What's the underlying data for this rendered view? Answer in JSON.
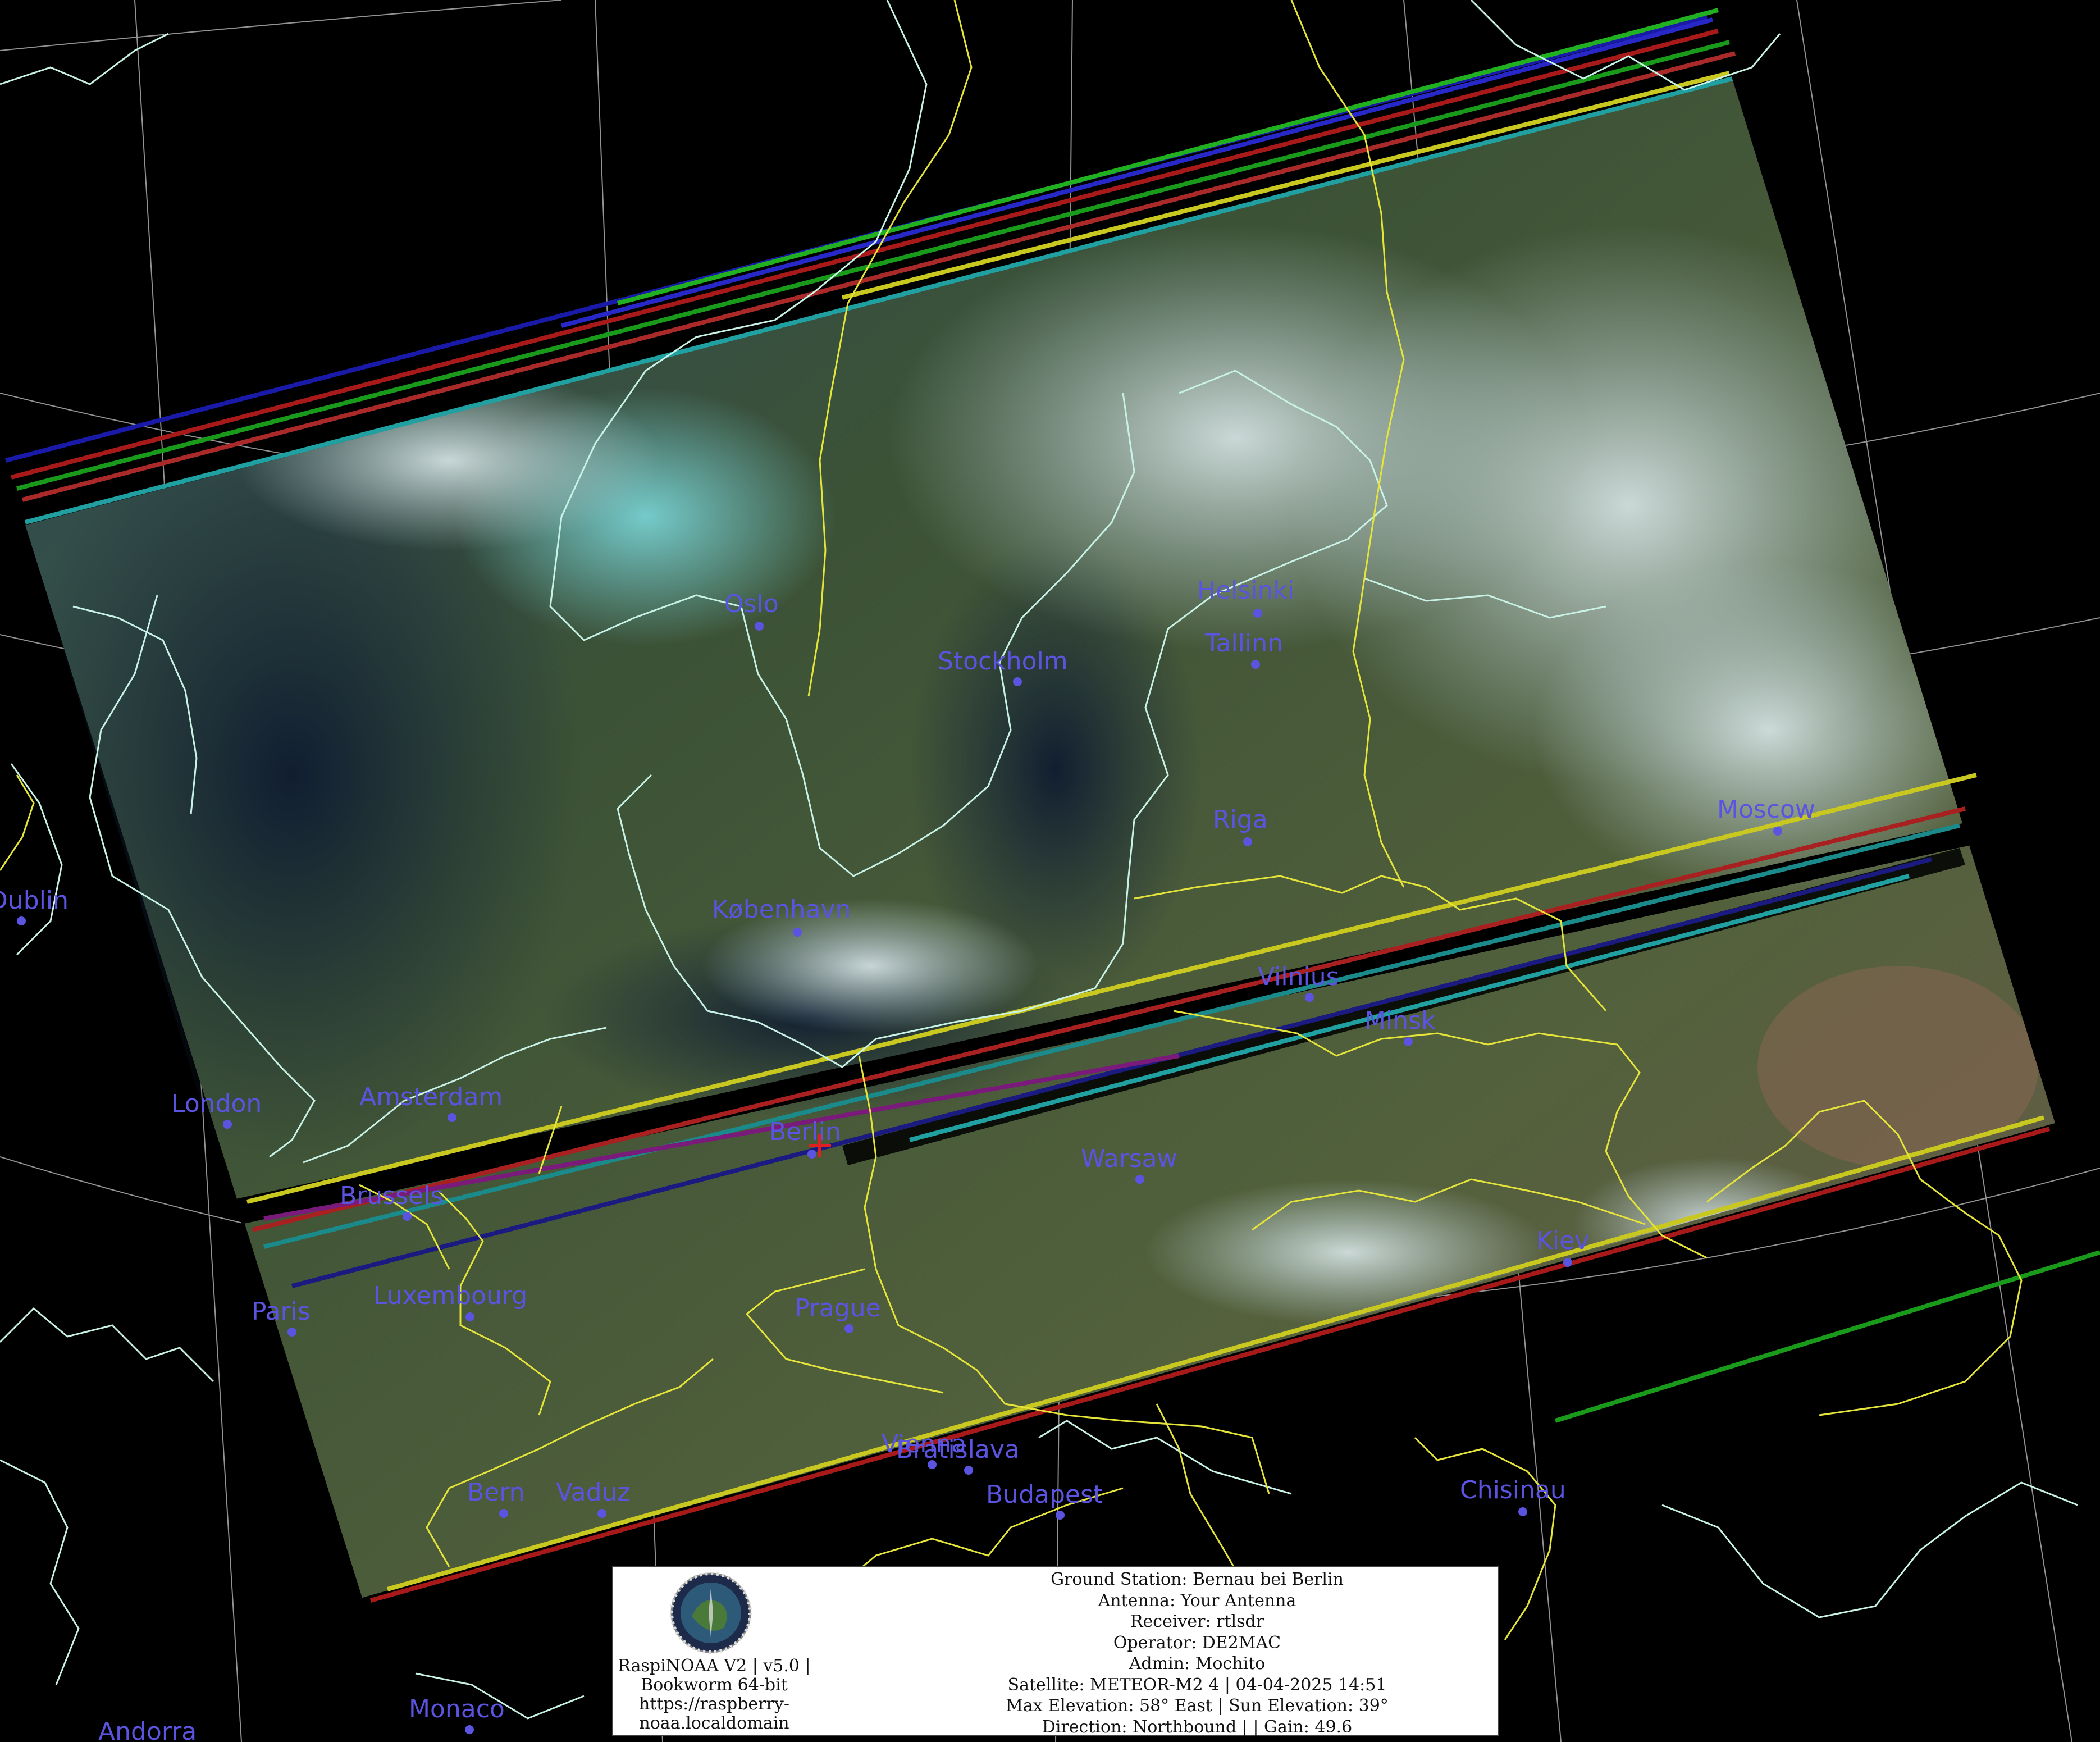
{
  "map": {
    "cities": [
      {
        "name": "Oslo"
      },
      {
        "name": "Stockholm"
      },
      {
        "name": "Helsinki"
      },
      {
        "name": "Tallinn"
      },
      {
        "name": "Riga"
      },
      {
        "name": "Moscow"
      },
      {
        "name": "København"
      },
      {
        "name": "Vilnius"
      },
      {
        "name": "Minsk"
      },
      {
        "name": "Dublin"
      },
      {
        "name": "London"
      },
      {
        "name": "Amsterdam"
      },
      {
        "name": "Berlin"
      },
      {
        "name": "Brussels"
      },
      {
        "name": "Warsaw"
      },
      {
        "name": "Kiev"
      },
      {
        "name": "Paris"
      },
      {
        "name": "Luxembourg"
      },
      {
        "name": "Prague"
      },
      {
        "name": "Vienna"
      },
      {
        "name": "Bratislava"
      },
      {
        "name": "Budapest"
      },
      {
        "name": "Bern"
      },
      {
        "name": "Vaduz"
      },
      {
        "name": "Chisinau"
      },
      {
        "name": "Monaco"
      },
      {
        "name": "Andorra"
      }
    ],
    "colors": {
      "background": "#000000",
      "coastline": "#c8f2e6",
      "borders": "#e4e43a",
      "graticule": "#b8b8b8",
      "city": "#5b54e0",
      "station_marker": "#e02020"
    }
  },
  "info": {
    "left": {
      "line1": "RaspiNOAA V2 | v5.0 |",
      "line2": "Bookworm 64-bit",
      "line3": "https://raspberry-",
      "line4": "noaa.localdomain"
    },
    "right": {
      "ground_station": "Ground Station: Bernau bei Berlin",
      "antenna": "Antenna: Your Antenna",
      "receiver": "Receiver: rtlsdr",
      "operator": "Operator: DE2MAC",
      "admin": "Admin: Mochito",
      "satellite": "Satellite: METEOR-M2 4 | 04-04-2025 14:51",
      "elevation": "Max Elevation: 58° East | Sun Elevation: 39°",
      "direction": "Direction: Northbound | | Gain: 49.6"
    }
  }
}
